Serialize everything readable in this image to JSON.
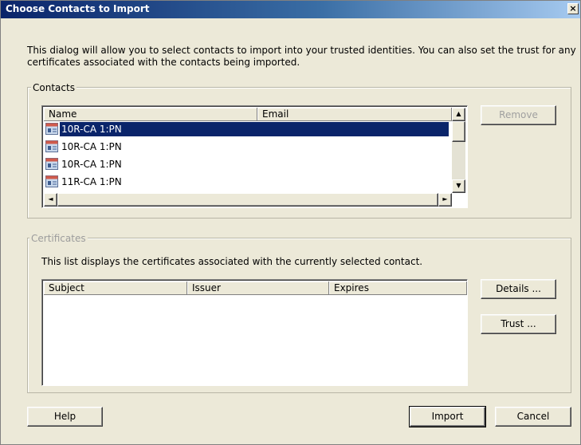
{
  "window": {
    "title": "Choose Contacts to Import",
    "close_glyph": "×"
  },
  "intro_text": "This dialog will allow you to select contacts to import into your trusted identities. You can also set the trust for any certificates associated with the contacts being imported.",
  "contacts": {
    "legend": "Contacts",
    "columns": [
      "Name",
      "Email"
    ],
    "rows": [
      {
        "name": "10R-CA 1:PN",
        "email": "",
        "selected": true
      },
      {
        "name": "10R-CA 1:PN",
        "email": "",
        "selected": false
      },
      {
        "name": "10R-CA 1:PN",
        "email": "",
        "selected": false
      },
      {
        "name": "11R-CA 1:PN",
        "email": "",
        "selected": false
      }
    ],
    "remove_label": "Remove"
  },
  "certificates": {
    "legend": "Certificates",
    "description": "This list displays the certificates associated with the currently selected contact.",
    "columns": [
      "Subject",
      "Issuer",
      "Expires"
    ],
    "details_label": "Details ...",
    "trust_label": "Trust ..."
  },
  "footer": {
    "help_label": "Help",
    "import_label": "Import",
    "cancel_label": "Cancel"
  },
  "icons": {
    "contact": "contact-card-icon",
    "scroll_up": "▲",
    "scroll_down": "▼",
    "scroll_left": "◄",
    "scroll_right": "►"
  }
}
